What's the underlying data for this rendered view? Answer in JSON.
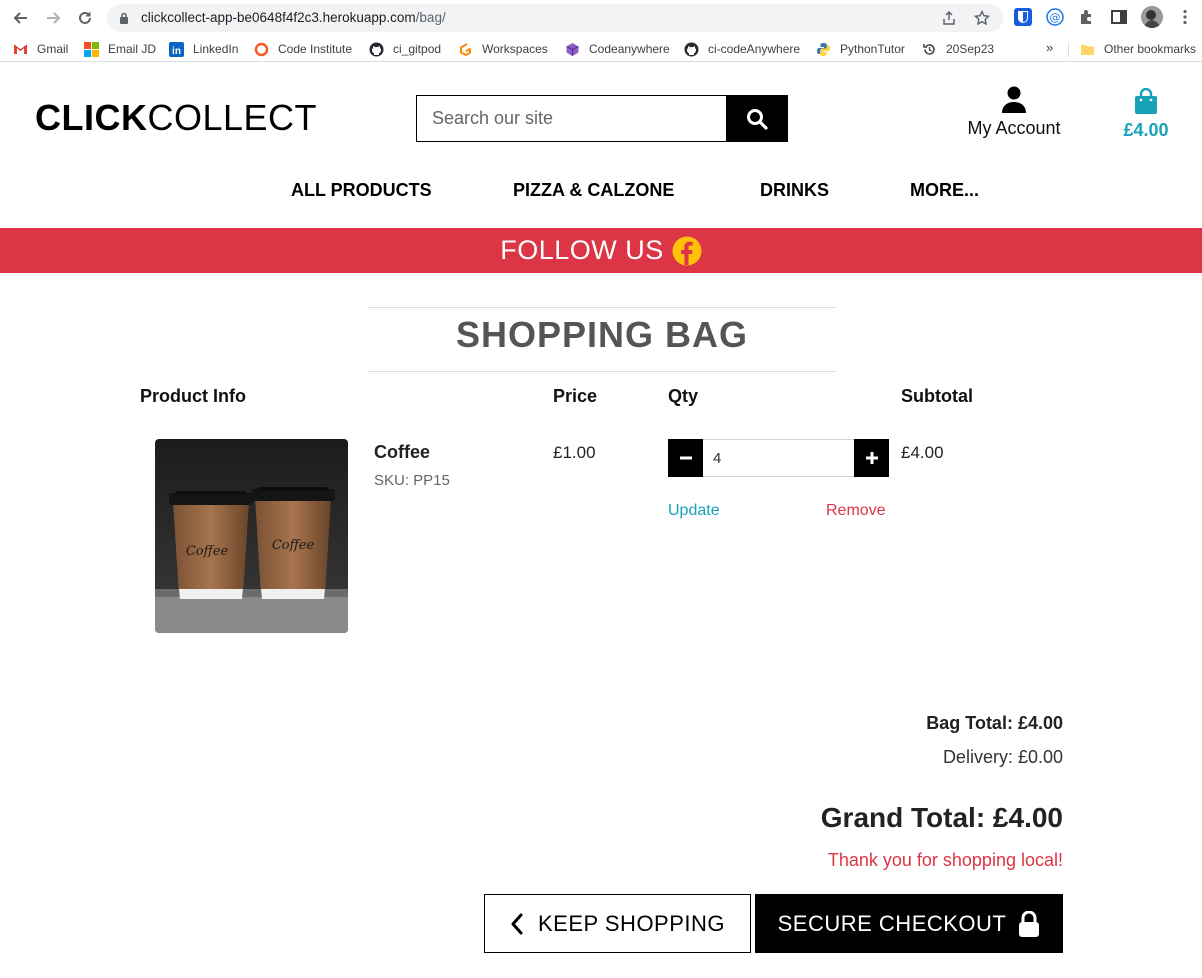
{
  "browser": {
    "url_host": "clickcollect-app-be0648f4f2c3.herokuapp.com",
    "url_path": "/bag/",
    "bookmarks": [
      {
        "label": "Gmail",
        "icon": "gmail-icon"
      },
      {
        "label": "Email JD",
        "icon": "microsoft-icon"
      },
      {
        "label": "LinkedIn",
        "icon": "linkedin-icon"
      },
      {
        "label": "Code Institute",
        "icon": "code-institute-icon"
      },
      {
        "label": "ci_gitpod",
        "icon": "github-icon"
      },
      {
        "label": "Workspaces",
        "icon": "gitpod-icon"
      },
      {
        "label": "Codeanywhere",
        "icon": "codeanywhere-icon"
      },
      {
        "label": "ci-codeAnywhere",
        "icon": "github-icon"
      },
      {
        "label": "PythonTutor",
        "icon": "python-icon"
      },
      {
        "label": "20Sep23",
        "icon": "history-icon"
      }
    ],
    "more_bookmarks": "»",
    "other_bookmarks": "Other bookmarks"
  },
  "site": {
    "logo_bold": "CLICK",
    "logo_rest": "COLLECT",
    "search_placeholder": "Search our site",
    "account_label": "My Account",
    "bag_total": "£4.00",
    "nav": [
      "ALL PRODUCTS",
      "PIZZA & CALZONE",
      "DRINKS",
      "MORE..."
    ],
    "banner_text": "FOLLOW US",
    "accent_color": "#17a2b8",
    "banner_color": "#dc3545"
  },
  "bag": {
    "title": "SHOPPING BAG",
    "headers": {
      "product": "Product Info",
      "price": "Price",
      "qty": "Qty",
      "subtotal": "Subtotal"
    },
    "items": [
      {
        "name": "Coffee",
        "sku": "SKU: PP15",
        "price": "£1.00",
        "qty": "4",
        "subtotal": "£4.00",
        "image_text": "Coffee"
      }
    ],
    "update_label": "Update",
    "remove_label": "Remove",
    "bag_total": "Bag Total: £4.00",
    "delivery": "Delivery: £0.00",
    "grand_total": "Grand Total: £4.00",
    "thanks": "Thank you for shopping local!",
    "keep_shopping": "KEEP SHOPPING",
    "checkout": "SECURE CHECKOUT"
  }
}
